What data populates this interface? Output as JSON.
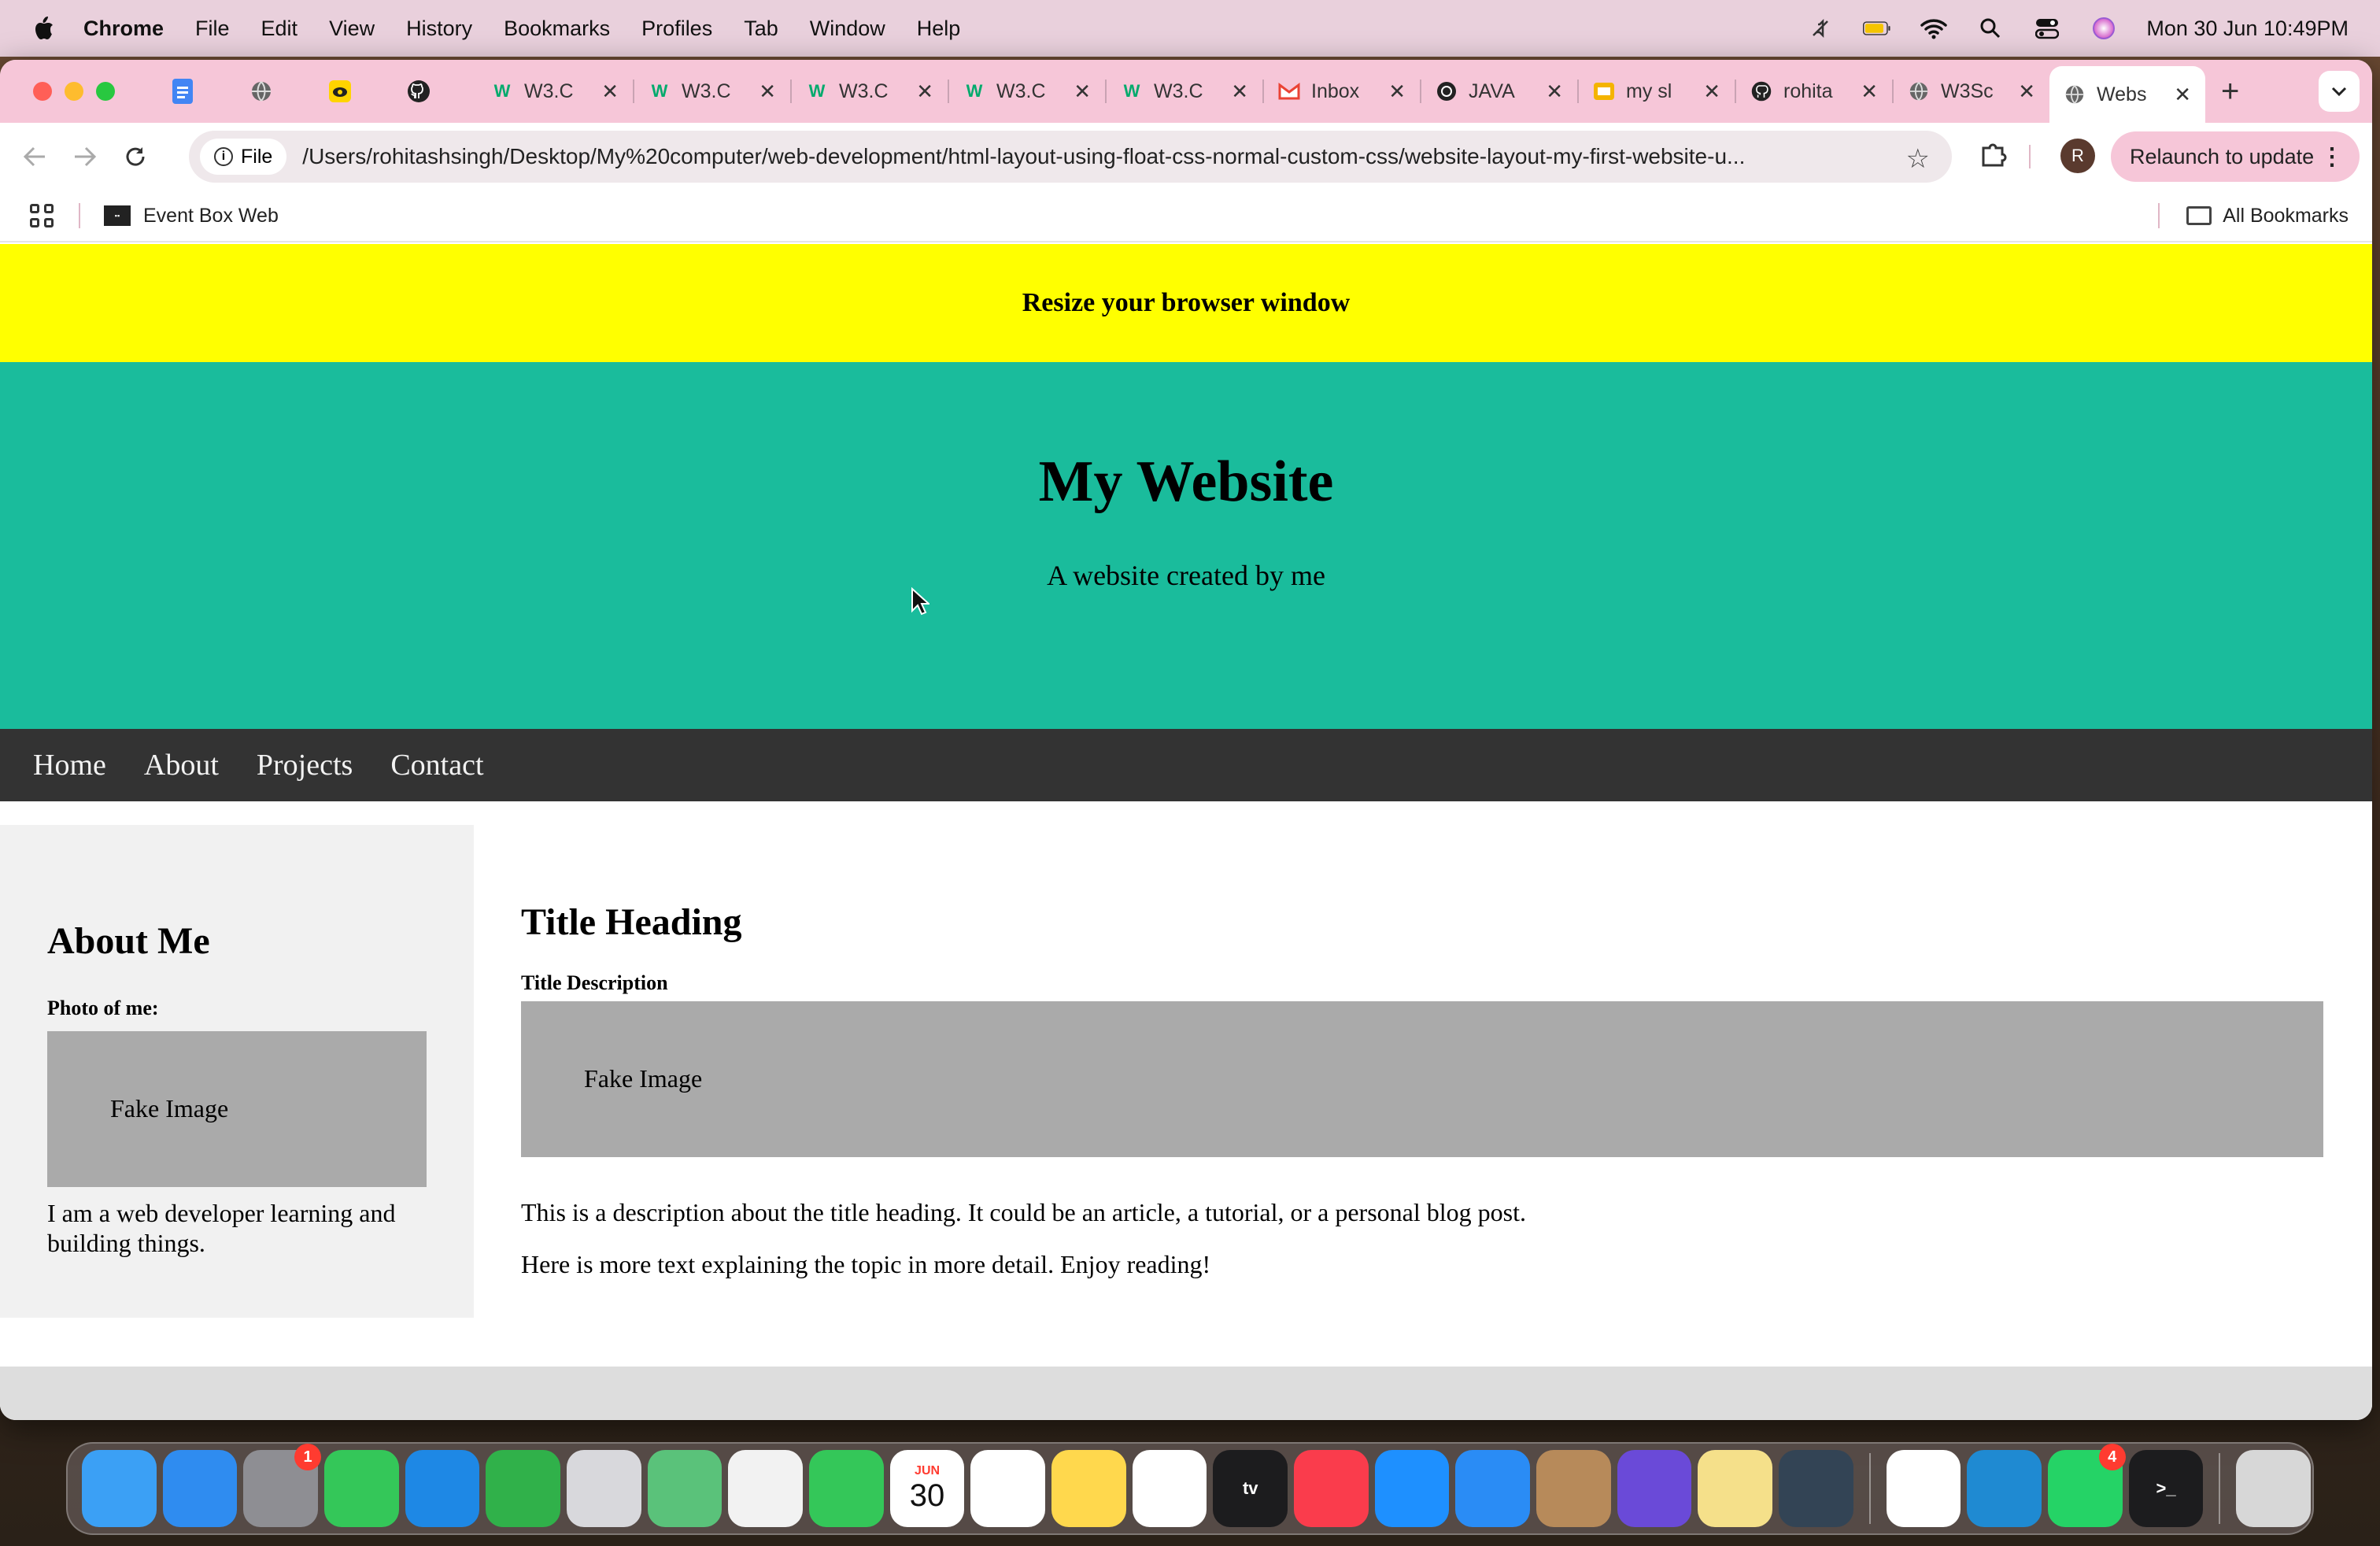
{
  "menubar": {
    "app_name": "Chrome",
    "items": [
      "File",
      "Edit",
      "View",
      "History",
      "Bookmarks",
      "Profiles",
      "Tab",
      "Window",
      "Help"
    ],
    "clock": "Mon 30 Jun  10:49PM",
    "status_icons": [
      "mute-icon",
      "battery-icon",
      "wifi-icon",
      "spotlight-icon",
      "control-center-icon",
      "siri-icon"
    ]
  },
  "tabs": [
    {
      "label": "",
      "icon": "docs-icon",
      "pinned": true
    },
    {
      "label": "",
      "icon": "globe-icon",
      "pinned": true
    },
    {
      "label": "",
      "icon": "extension-yellow-icon",
      "pinned": true
    },
    {
      "label": "",
      "icon": "github-icon",
      "pinned": true
    },
    {
      "label": "W3.C",
      "icon": "w3schools-icon"
    },
    {
      "label": "W3.C",
      "icon": "w3schools-icon"
    },
    {
      "label": "W3.C",
      "icon": "w3schools-icon"
    },
    {
      "label": "W3.C",
      "icon": "w3schools-icon"
    },
    {
      "label": "W3.C",
      "icon": "w3schools-icon"
    },
    {
      "label": "Inbox",
      "icon": "gmail-icon"
    },
    {
      "label": "JAVA",
      "icon": "chatgpt-icon"
    },
    {
      "label": "my sl",
      "icon": "slides-icon"
    },
    {
      "label": "rohita",
      "icon": "github-icon"
    },
    {
      "label": "W3Sc",
      "icon": "globe-icon"
    },
    {
      "label": "Webs",
      "icon": "globe-icon",
      "active": true
    }
  ],
  "toolbar": {
    "chip_label": "File",
    "url": "/Users/rohitashsingh/Desktop/My%20computer/web-development/html-layout-using-float-css-normal-custom-css/website-layout-my-first-website-u...",
    "avatar_letter": "R",
    "relaunch_label": "Relaunch to update"
  },
  "bookmarks": {
    "items": [
      {
        "label": "Event Box Web",
        "icon": "eventbox-icon"
      }
    ],
    "all_label": "All Bookmarks"
  },
  "page": {
    "banner": "Resize your browser window",
    "header_title": "My Website",
    "header_subtitle": "A website created by me",
    "nav": [
      "Home",
      "About",
      "Projects",
      "Contact"
    ],
    "sidebar": {
      "heading": "About Me",
      "subheading": "Photo of me:",
      "image_label": "Fake Image",
      "text": "I am a web developer learning and building things."
    },
    "main": {
      "heading": "Title Heading",
      "subheading": "Title Description",
      "image_label": "Fake Image",
      "para1": "This is a description about the title heading. It could be an article, a tutorial, or a personal blog post.",
      "para2": "Here is more text explaining the topic in more detail. Enjoy reading!"
    }
  },
  "colors": {
    "banner": "#ffff00",
    "header": "#1abc9c",
    "nav": "#333333",
    "sidebar": "#f1f1f1",
    "fake_image": "#aaaaaa"
  },
  "dock": {
    "apps": [
      {
        "name": "finder-icon",
        "color": "#3ba0f5"
      },
      {
        "name": "safari-icon",
        "color": "#2f8cf0"
      },
      {
        "name": "system-settings-icon",
        "color": "#8e8e93",
        "badge": "1"
      },
      {
        "name": "messages-icon",
        "color": "#34c759"
      },
      {
        "name": "mail-icon",
        "color": "#1e88e5"
      },
      {
        "name": "numbers-icon",
        "color": "#30b14a"
      },
      {
        "name": "launchpad-icon",
        "color": "#d8d8dc"
      },
      {
        "name": "maps-icon",
        "color": "#5ac27a"
      },
      {
        "name": "photos-icon",
        "color": "#f2f2f2"
      },
      {
        "name": "facetime-icon",
        "color": "#34c759"
      },
      {
        "name": "calendar-icon",
        "color": "#ffffff",
        "text": "30",
        "month": "JUN"
      },
      {
        "name": "reminders-icon",
        "color": "#ffffff"
      },
      {
        "name": "notes-icon",
        "color": "#ffd84d"
      },
      {
        "name": "freeform-icon",
        "color": "#ffffff"
      },
      {
        "name": "apple-tv-icon",
        "color": "#1c1c1e",
        "text": "tv"
      },
      {
        "name": "music-icon",
        "color": "#fa3c4c"
      },
      {
        "name": "app-store-icon",
        "color": "#1e90ff"
      },
      {
        "name": "keynote-icon",
        "color": "#2a8cf5"
      },
      {
        "name": "contacts-icon",
        "color": "#b78a5a"
      },
      {
        "name": "imovie-icon",
        "color": "#6a4ad8"
      },
      {
        "name": "stickies-icon",
        "color": "#f5e08a"
      },
      {
        "name": "quicktime-icon",
        "color": "#334455"
      },
      {
        "name": "chrome-icon",
        "color": "#ffffff"
      },
      {
        "name": "vscode-icon",
        "color": "#1f8ad2"
      },
      {
        "name": "whatsapp-icon",
        "color": "#25d366",
        "badge": "4"
      },
      {
        "name": "terminal-icon",
        "color": "#1c1c1e",
        "text": ">_"
      },
      {
        "name": "trash-icon",
        "color": "#d7d7d7"
      }
    ]
  }
}
